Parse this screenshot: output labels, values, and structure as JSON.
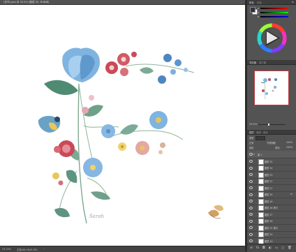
{
  "document": {
    "tab_title": "(花鸟).psd @ 33.3% (图层 55, RGB/8)",
    "close_glyph": "×",
    "signature_text": "Sarah"
  },
  "status_bar": {
    "zoom": "33.33%",
    "doc_size": "文档:66.1M/6.78G",
    "more_glyph": "›"
  },
  "color_panel": {
    "tab_color": "颜色",
    "tab_swatches": "色板",
    "menu_glyph": "≡",
    "foreground_color": "#2f3340",
    "background_color": "#ffffff",
    "sliders": [
      {
        "label": "R",
        "value": ""
      },
      {
        "label": "G",
        "value": ""
      },
      {
        "label": "B",
        "value": ""
      }
    ]
  },
  "navigator_panel": {
    "tab_navigator": "导航器",
    "tab_histogram": "直方图",
    "zoom_value": "33.33%"
  },
  "layers_panel": {
    "tabs": [
      "图层",
      "通道",
      "路径"
    ],
    "kind_label": "类型",
    "blend_mode": "正常",
    "opacity_label": "不透明度:",
    "opacity_value": "100%",
    "lock_label": "锁定:",
    "fill_label": "填充:",
    "fill_value": "100%",
    "group_name": "组 1",
    "layers": [
      {
        "name": "图层 55",
        "fx": ""
      },
      {
        "name": "图层 54",
        "fx": ""
      },
      {
        "name": "图层 53",
        "fx": ""
      },
      {
        "name": "图层 52",
        "fx": ""
      },
      {
        "name": "图层 51",
        "fx": ""
      },
      {
        "name": "图层 50",
        "fx": "fx"
      },
      {
        "name": "图层 49",
        "fx": ""
      },
      {
        "name": "图层 48 拷贝",
        "fx": ""
      },
      {
        "name": "图层 47",
        "fx": ""
      },
      {
        "name": "图层 46",
        "fx": ""
      },
      {
        "name": "图层 45 拷贝",
        "fx": ""
      },
      {
        "name": "图层 44",
        "fx": ""
      },
      {
        "name": "图层 43",
        "fx": ""
      }
    ],
    "footer_icons": [
      "link-icon",
      "fx-icon",
      "mask-icon",
      "adjustment-icon",
      "folder-icon",
      "new-layer-icon",
      "trash-icon"
    ],
    "footer_glyphs": [
      "⊝",
      "fx",
      "◘",
      "◐",
      "▭",
      "▢",
      "🗑"
    ]
  }
}
